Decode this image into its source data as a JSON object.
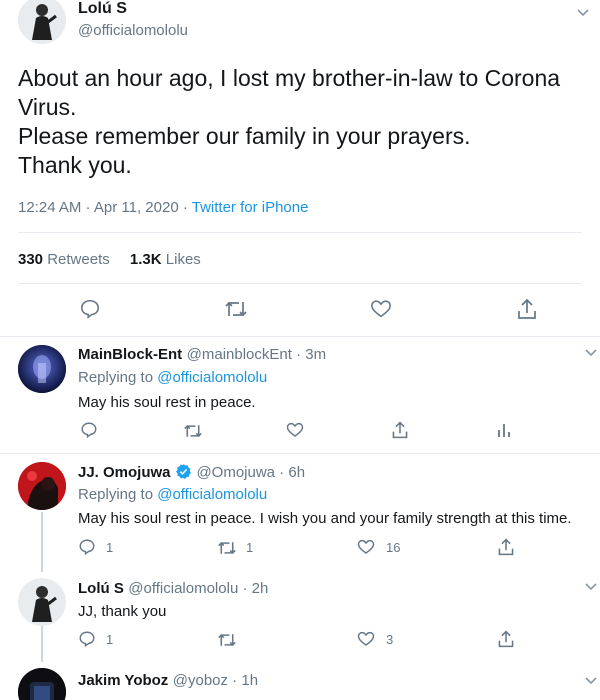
{
  "main_tweet": {
    "name": "Lolú S",
    "handle": "@officialomololu",
    "text_lines": [
      "About an hour ago, I lost my brother-in-law to Corona",
      "Virus.",
      "Please remember our family in your prayers.",
      "Thank you."
    ],
    "time": "12:24 AM · Apr 11, 2020 · ",
    "source": "Twitter for iPhone",
    "retweets_count": "330",
    "retweets_label": "Retweets",
    "likes_count": "1.3K",
    "likes_label": "Likes"
  },
  "replies": [
    {
      "name": "MainBlock-Ent",
      "handle_time": "@mainblockEnt · 3m",
      "replying_label": "Replying to ",
      "replying_to": "@officialomololu",
      "text": "May his soul rest in peace."
    },
    {
      "name": "JJ. Omojuwa",
      "handle_time": "@Omojuwa · 6h",
      "replying_label": "Replying to ",
      "replying_to": "@officialomololu",
      "text": "May his soul rest in peace. I wish you and your family strength at this time.",
      "reply_count": "1",
      "retweet_count": "1",
      "like_count": "16"
    },
    {
      "name": "Lolú S",
      "handle_time": "@officialomololu · 2h",
      "text": "JJ, thank you",
      "reply_count": "1",
      "like_count": "3"
    },
    {
      "name": "Jakim Yoboz",
      "handle_time": "@yoboz · 1h"
    }
  ],
  "colors": {
    "accent": "#1b95e0",
    "muted": "#657786",
    "verified": "#1da1f2"
  },
  "icons": [
    "reply-icon",
    "retweet-icon",
    "like-icon",
    "share-icon",
    "analytics-icon",
    "chevron-down-icon",
    "verified-badge-icon"
  ]
}
